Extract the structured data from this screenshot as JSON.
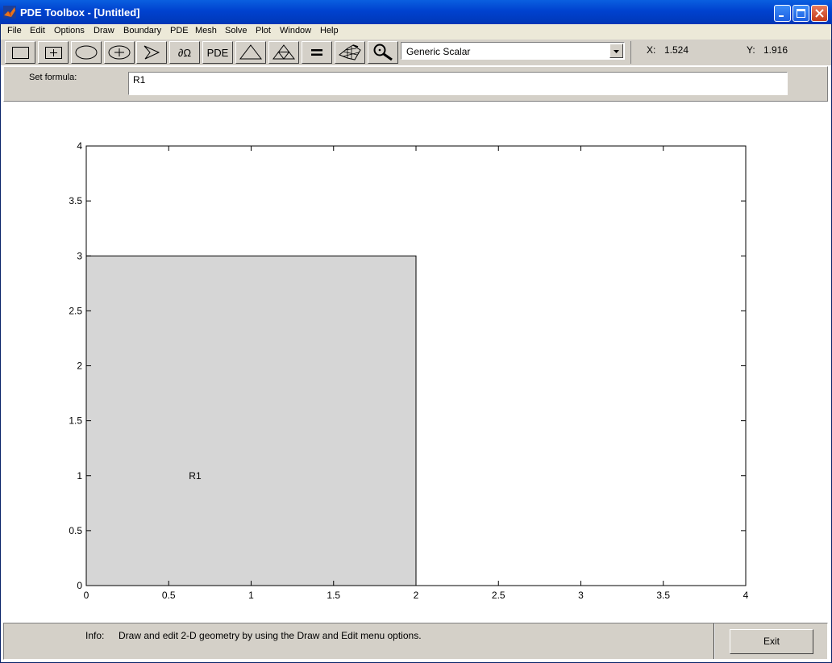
{
  "window": {
    "title": "PDE Toolbox - [Untitled]"
  },
  "menu": [
    "File",
    "Edit",
    "Options",
    "Draw",
    "Boundary",
    "PDE",
    "Mesh",
    "Solve",
    "Plot",
    "Window",
    "Help"
  ],
  "toolbar": {
    "buttons": [
      {
        "name": "draw-rectangle-corner-button",
        "icon": "rectangle-icon"
      },
      {
        "name": "draw-rectangle-center-button",
        "icon": "rectangle-center-icon"
      },
      {
        "name": "draw-ellipse-corner-button",
        "icon": "ellipse-icon"
      },
      {
        "name": "draw-ellipse-center-button",
        "icon": "ellipse-center-icon"
      },
      {
        "name": "draw-polygon-button",
        "icon": "polygon-icon"
      },
      {
        "name": "boundary-mode-button",
        "label": "∂Ω"
      },
      {
        "name": "pde-specification-button",
        "label": "PDE"
      },
      {
        "name": "init-mesh-button",
        "icon": "triangle-icon"
      },
      {
        "name": "refine-mesh-button",
        "icon": "refine-triangle-icon"
      },
      {
        "name": "solve-pde-button",
        "icon": "equals-icon"
      },
      {
        "name": "plot-solution-button",
        "icon": "surface-plot-icon"
      },
      {
        "name": "zoom-button",
        "icon": "magnifier-icon"
      }
    ],
    "application_mode": "Generic Scalar",
    "x_label": "X:",
    "x_value": "1.524",
    "y_label": "Y:",
    "y_value": "1.916"
  },
  "formula": {
    "label": "Set formula:",
    "value": "R1"
  },
  "chart_data": {
    "type": "scatter",
    "title": "",
    "xlabel": "",
    "ylabel": "",
    "xlim": [
      0,
      4
    ],
    "ylim": [
      0,
      4
    ],
    "x_ticks": [
      "0",
      "0.5",
      "1",
      "1.5",
      "2",
      "2.5",
      "3",
      "3.5",
      "4"
    ],
    "y_ticks": [
      "0",
      "0.5",
      "1",
      "1.5",
      "2",
      "2.5",
      "3",
      "3.5",
      "4"
    ],
    "shapes": [
      {
        "label": "R1",
        "kind": "rectangle",
        "x": [
          0,
          2
        ],
        "y": [
          0,
          3
        ],
        "label_x": 0.66,
        "label_y": 1.0,
        "fill": "#d6d6d6"
      }
    ],
    "grid": false
  },
  "info": {
    "label": "Info:",
    "text": "Draw and edit 2-D geometry by using the Draw and Edit menu options."
  },
  "exit_label": "Exit"
}
